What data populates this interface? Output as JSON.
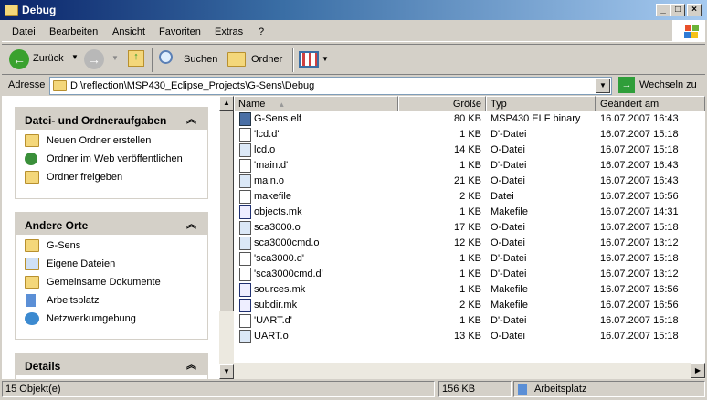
{
  "window": {
    "title": "Debug"
  },
  "menu": [
    "Datei",
    "Bearbeiten",
    "Ansicht",
    "Favoriten",
    "Extras",
    "?"
  ],
  "toolbar": {
    "back": "Zurück",
    "search": "Suchen",
    "folders": "Ordner"
  },
  "address": {
    "label": "Adresse",
    "value": "D:\\reflection\\MSP430_Eclipse_Projects\\G-Sens\\Debug",
    "go": "Wechseln zu"
  },
  "tasks": {
    "title": "Datei- und Ordneraufgaben",
    "items": [
      "Neuen Ordner erstellen",
      "Ordner im Web veröffentlichen",
      "Ordner freigeben"
    ]
  },
  "places": {
    "title": "Andere Orte",
    "items": [
      "G-Sens",
      "Eigene Dateien",
      "Gemeinsame Dokumente",
      "Arbeitsplatz",
      "Netzwerkumgebung"
    ]
  },
  "details": {
    "title": "Details"
  },
  "columns": {
    "name": "Name",
    "size": "Größe",
    "type": "Typ",
    "modified": "Geändert am"
  },
  "files": [
    {
      "name": "G-Sens.elf",
      "size": "80 KB",
      "type": "MSP430 ELF binary",
      "modified": "16.07.2007 16:43",
      "icon": "elf"
    },
    {
      "name": "'lcd.d'",
      "size": "1 KB",
      "type": "D'-Datei",
      "modified": "16.07.2007 15:18",
      "icon": "d"
    },
    {
      "name": "lcd.o",
      "size": "14 KB",
      "type": "O-Datei",
      "modified": "16.07.2007 15:18",
      "icon": "o"
    },
    {
      "name": "'main.d'",
      "size": "1 KB",
      "type": "D'-Datei",
      "modified": "16.07.2007 16:43",
      "icon": "d"
    },
    {
      "name": "main.o",
      "size": "21 KB",
      "type": "O-Datei",
      "modified": "16.07.2007 16:43",
      "icon": "o"
    },
    {
      "name": "makefile",
      "size": "2 KB",
      "type": "Datei",
      "modified": "16.07.2007 16:56",
      "icon": "d"
    },
    {
      "name": "objects.mk",
      "size": "1 KB",
      "type": "Makefile",
      "modified": "16.07.2007 14:31",
      "icon": "mk"
    },
    {
      "name": "sca3000.o",
      "size": "17 KB",
      "type": "O-Datei",
      "modified": "16.07.2007 15:18",
      "icon": "o"
    },
    {
      "name": "sca3000cmd.o",
      "size": "12 KB",
      "type": "O-Datei",
      "modified": "16.07.2007 13:12",
      "icon": "o"
    },
    {
      "name": "'sca3000.d'",
      "size": "1 KB",
      "type": "D'-Datei",
      "modified": "16.07.2007 15:18",
      "icon": "d"
    },
    {
      "name": "'sca3000cmd.d'",
      "size": "1 KB",
      "type": "D'-Datei",
      "modified": "16.07.2007 13:12",
      "icon": "d"
    },
    {
      "name": "sources.mk",
      "size": "1 KB",
      "type": "Makefile",
      "modified": "16.07.2007 16:56",
      "icon": "mk"
    },
    {
      "name": "subdir.mk",
      "size": "2 KB",
      "type": "Makefile",
      "modified": "16.07.2007 16:56",
      "icon": "mk"
    },
    {
      "name": "'UART.d'",
      "size": "1 KB",
      "type": "D'-Datei",
      "modified": "16.07.2007 15:18",
      "icon": "d"
    },
    {
      "name": "UART.o",
      "size": "13 KB",
      "type": "O-Datei",
      "modified": "16.07.2007 15:18",
      "icon": "o"
    }
  ],
  "status": {
    "count": "15 Objekt(e)",
    "size": "156 KB",
    "zone": "Arbeitsplatz"
  }
}
